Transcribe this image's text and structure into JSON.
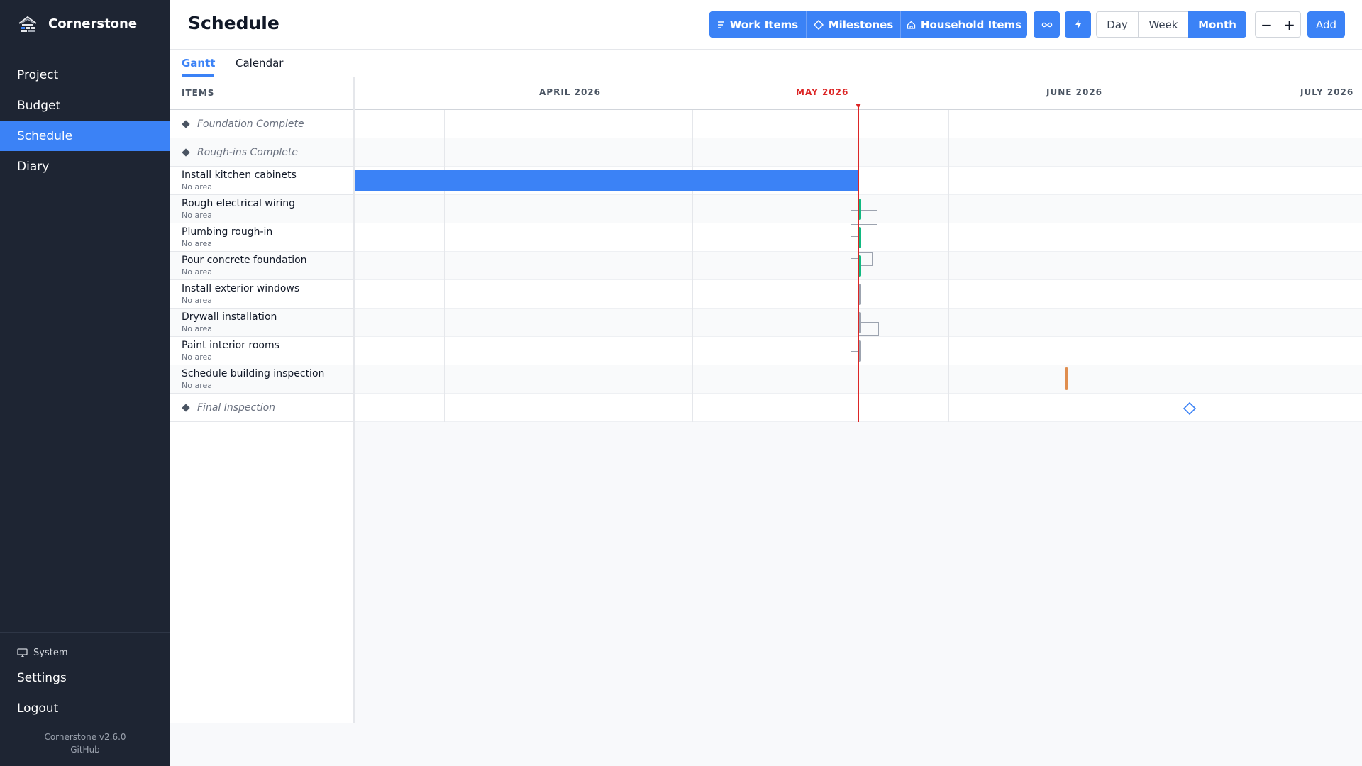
{
  "app": {
    "name": "Cornerstone",
    "version": "Cornerstone v2.6.0",
    "github": "GitHub"
  },
  "sidebar": {
    "items": [
      {
        "label": "Project",
        "active": false
      },
      {
        "label": "Budget",
        "active": false
      },
      {
        "label": "Schedule",
        "active": true
      },
      {
        "label": "Diary",
        "active": false
      }
    ],
    "system": "System",
    "settings": "Settings",
    "logout": "Logout"
  },
  "header": {
    "title": "Schedule",
    "filters": {
      "work_items": "Work Items",
      "milestones": "Milestones",
      "household_items": "Household Items"
    },
    "views": {
      "day": "Day",
      "week": "Week",
      "month": "Month",
      "active": "Month"
    },
    "zoom_out": "−",
    "zoom_in": "+",
    "add": "Add"
  },
  "tabs": {
    "gantt": "Gantt",
    "calendar": "Calendar",
    "active": "Gantt"
  },
  "gantt": {
    "items_header": "ITEMS",
    "months": [
      "APRIL 2026",
      "MAY 2026",
      "JUNE 2026",
      "JULY 2026"
    ],
    "current_month": "MAY 2026",
    "rows": [
      {
        "type": "milestone",
        "label": "Foundation Complete"
      },
      {
        "type": "milestone",
        "label": "Rough-ins Complete"
      },
      {
        "type": "item",
        "title": "Install kitchen cabinets",
        "area": "No area"
      },
      {
        "type": "item",
        "title": "Rough electrical wiring",
        "area": "No area"
      },
      {
        "type": "item",
        "title": "Plumbing rough-in",
        "area": "No area"
      },
      {
        "type": "item",
        "title": "Pour concrete foundation",
        "area": "No area"
      },
      {
        "type": "item",
        "title": "Install exterior windows",
        "area": "No area"
      },
      {
        "type": "item",
        "title": "Drywall installation",
        "area": "No area"
      },
      {
        "type": "item",
        "title": "Paint interior rooms",
        "area": "No area"
      },
      {
        "type": "item",
        "title": "Schedule building inspection",
        "area": "No area"
      },
      {
        "type": "milestone",
        "label": "Final Inspection"
      }
    ],
    "colors": {
      "in_progress": "#3b82f6",
      "completed": "#10b981",
      "not_started": "#9ca3af",
      "household": "#e08e4f",
      "milestone": "#3b82f6",
      "today": "#dc2626"
    }
  }
}
